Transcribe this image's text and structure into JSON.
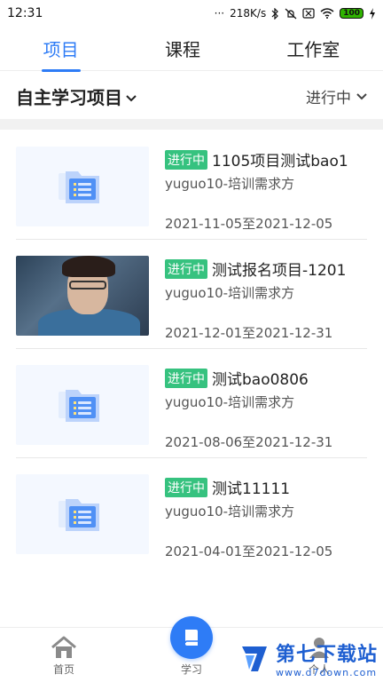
{
  "status_bar": {
    "time": "12:31",
    "network_speed": "218K/s",
    "battery_level": "100",
    "icons": [
      "signal-dots",
      "bluetooth-icon",
      "mute-icon",
      "sim-off-icon",
      "wifi-icon",
      "battery-icon",
      "charging-icon"
    ]
  },
  "tabs": [
    {
      "label": "项目",
      "active": true
    },
    {
      "label": "课程",
      "active": false
    },
    {
      "label": "工作室",
      "active": false
    }
  ],
  "filter": {
    "category_label": "自主学习项目",
    "status_label": "进行中"
  },
  "projects": [
    {
      "badge": "进行中",
      "title": "1105项目测试bao1",
      "org": "yuguo10-培训需求方",
      "dates": "2021-11-05至2021-12-05",
      "thumb": "folder"
    },
    {
      "badge": "进行中",
      "title": "测试报名项目-1201",
      "org": "yuguo10-培训需求方",
      "dates": "2021-12-01至2021-12-31",
      "thumb": "photo"
    },
    {
      "badge": "进行中",
      "title": "测试bao0806",
      "org": "yuguo10-培训需求方",
      "dates": "2021-08-06至2021-12-31",
      "thumb": "folder"
    },
    {
      "badge": "进行中",
      "title": "测试11111",
      "org": "yuguo10-培训需求方",
      "dates": "2021-04-01至2021-12-05",
      "thumb": "folder"
    }
  ],
  "bottom_nav": [
    {
      "label": "首页",
      "icon": "home-icon",
      "active": false
    },
    {
      "label": "学习",
      "icon": "book-icon",
      "active": true
    },
    {
      "label": "个人",
      "icon": "person-icon",
      "active": false
    }
  ],
  "watermark": {
    "title": "第七下载站",
    "url": "www.d7down.com"
  },
  "colors": {
    "accent": "#2e7cf6",
    "badge": "#36c27f",
    "watermark": "#1e5fd1"
  }
}
